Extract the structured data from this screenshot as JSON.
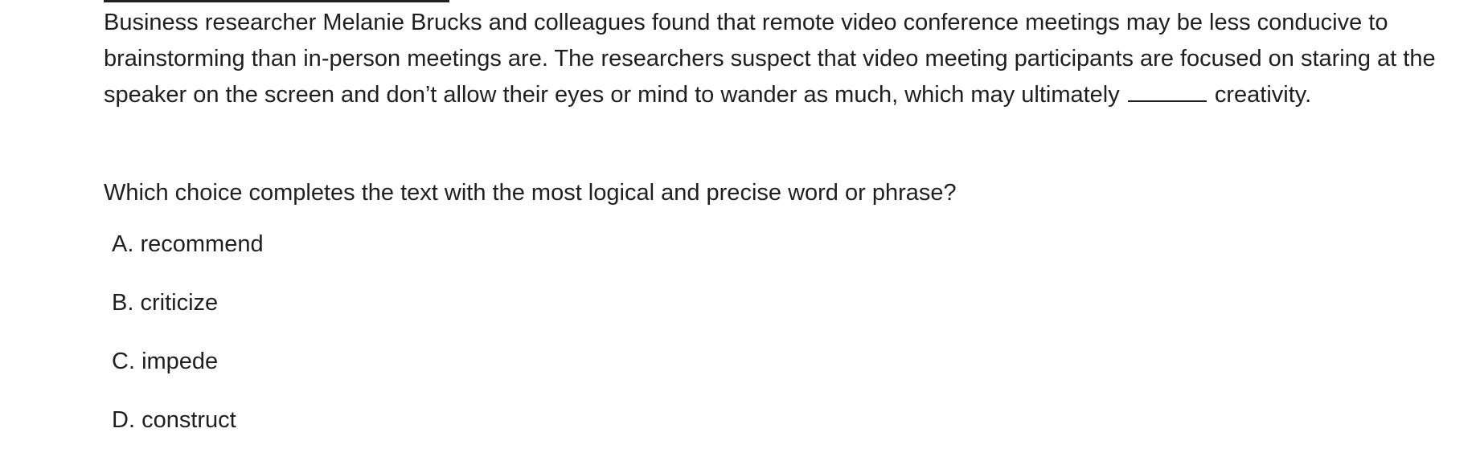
{
  "passage": {
    "before_blank": "Business researcher Melanie Brucks and colleagues found that remote video conference meetings may be less conducive to brainstorming than in-person meetings are. The researchers suspect that video meeting participants are focused on staring at the speaker on the screen and don’t allow their eyes or mind to wander as much, which may ultimately",
    "after_blank": "creativity."
  },
  "question": "Which choice completes the text with the most logical and precise word or phrase?",
  "choices": [
    {
      "letter": "A.",
      "text": "recommend"
    },
    {
      "letter": "B.",
      "text": "criticize"
    },
    {
      "letter": "C.",
      "text": "impede"
    },
    {
      "letter": "D.",
      "text": "construct"
    }
  ]
}
